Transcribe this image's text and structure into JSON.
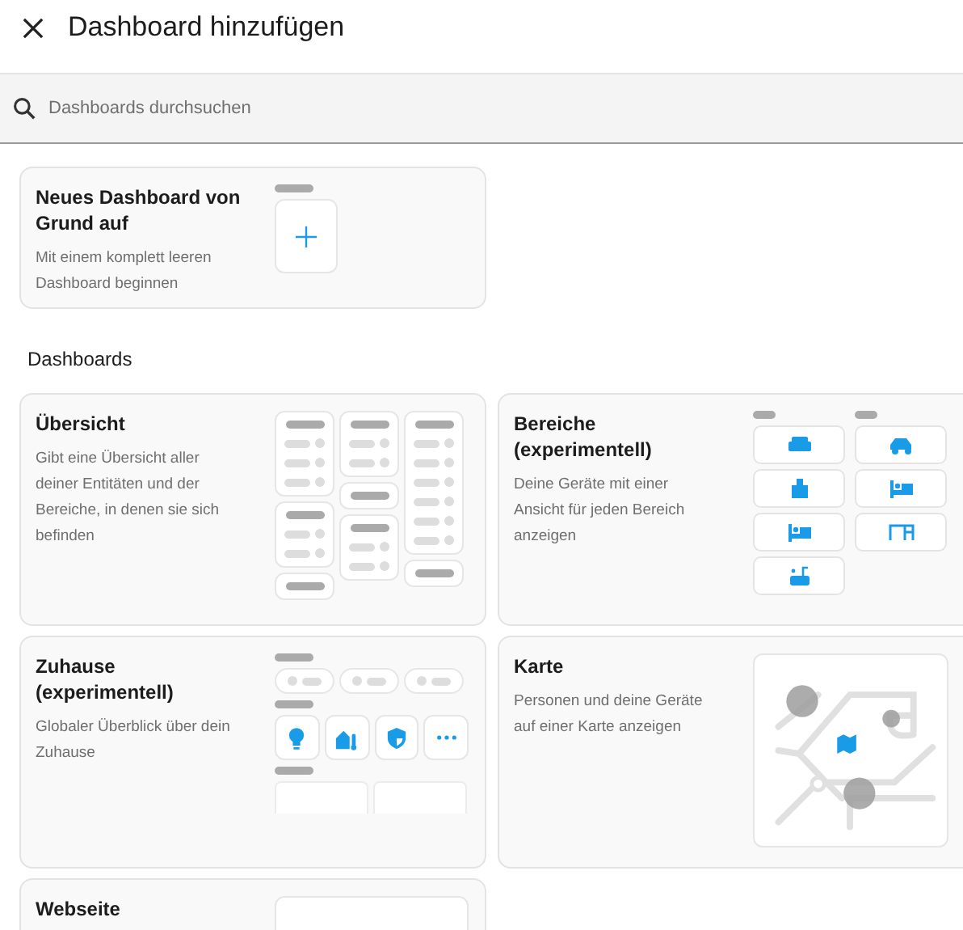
{
  "dialog": {
    "title": "Dashboard hinzufügen"
  },
  "search": {
    "placeholder": "Dashboards durchsuchen"
  },
  "new_dashboard": {
    "title": "Neues Dashboard von Grund auf",
    "description": "Mit einem komplett leeren Dashboard beginnen"
  },
  "section_heading": "Dashboards",
  "dashboards": [
    {
      "kind": "overview",
      "title": "Übersicht",
      "description": "Gibt eine Übersicht aller deiner Entitäten und der Bereiche, in denen sie sich befinden"
    },
    {
      "kind": "areas",
      "title": "Bereiche (experimentell)",
      "description": "Deine Geräte mit einer Ansicht für jeden Bereich anzeigen"
    },
    {
      "kind": "home",
      "title": "Zuhause (experimentell)",
      "description": "Globaler Überblick über dein Zuhause"
    },
    {
      "kind": "map",
      "title": "Karte",
      "description": "Personen und deine Geräte auf einer Karte anzeigen"
    },
    {
      "kind": "webpage",
      "title": "Webseite"
    }
  ]
}
